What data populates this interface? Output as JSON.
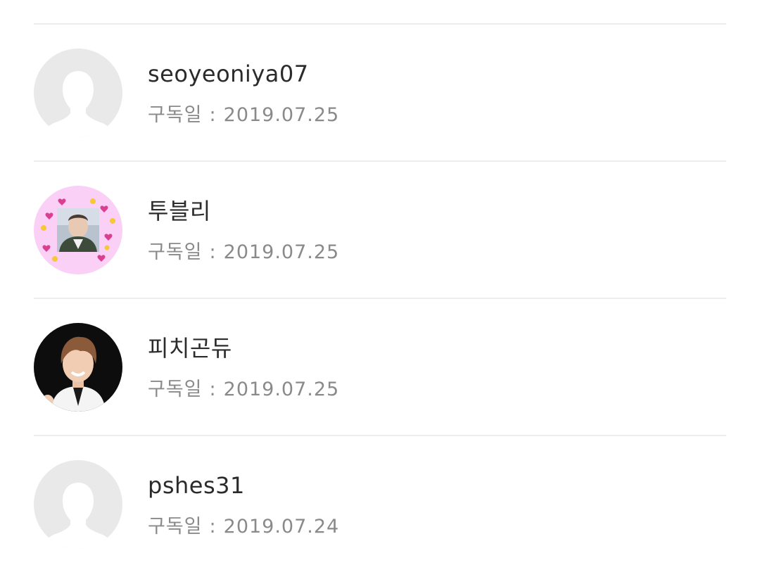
{
  "subscribers": [
    {
      "username": "seoyeoniya07",
      "date_label": "구독일",
      "separator": ":",
      "date": "2019.07.25",
      "avatar": "default-profile-icon"
    },
    {
      "username": "투블리",
      "date_label": "구독일",
      "separator": ":",
      "date": "2019.07.25",
      "avatar": "pink-heart-frame-photo"
    },
    {
      "username": "피치곤듀",
      "date_label": "구독일",
      "separator": ":",
      "date": "2019.07.25",
      "avatar": "portrait-photo"
    },
    {
      "username": "pshes31",
      "date_label": "구독일",
      "separator": ":",
      "date": "2019.07.24",
      "avatar": "default-profile-icon"
    }
  ],
  "colors": {
    "divider": "#ededed",
    "name_text": "#2b2b2b",
    "date_text": "#8a8a8a",
    "default_avatar_bg": "#e9e9e9",
    "pink_avatar_bg": "#fbd0f7"
  }
}
